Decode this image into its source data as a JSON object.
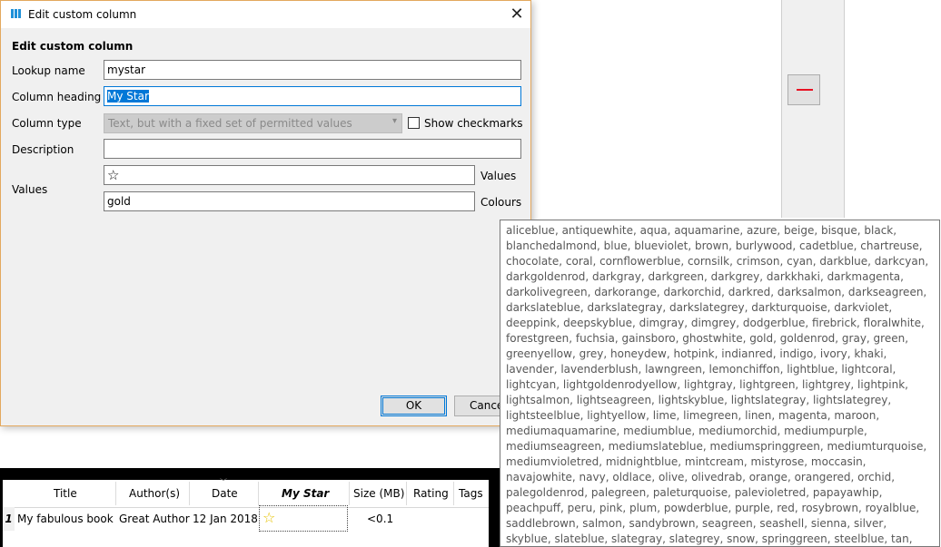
{
  "dialog": {
    "title": "Edit custom column",
    "heading": "Edit custom column",
    "lookup_name_label": "Lookup name",
    "lookup_name_value": "mystar",
    "column_heading_label": "Column heading",
    "column_heading_value": "My Star",
    "column_type_label": "Column type",
    "column_type_value": "Text, but with a fixed set of permitted values",
    "show_checkmarks_label": "Show checkmarks",
    "description_label": "Description",
    "description_value": "",
    "values_label": "Values",
    "values_value": "☆",
    "values_side_label": "Values",
    "colours_value": "gold",
    "colours_side_label": "Colours",
    "ok_label": "OK",
    "cancel_label": "Cancel",
    "close_glyph": "✕"
  },
  "remove_button": {
    "icon": "minus-icon",
    "color": "#e81123"
  },
  "table": {
    "columns": [
      "Title",
      "Author(s)",
      "Date",
      "My Star",
      "Size (MB)",
      "Rating",
      "Tags"
    ],
    "row": {
      "num": "1",
      "title": "My fabulous book",
      "author": "Great Author",
      "date": "12 Jan 2018",
      "star": "☆",
      "size": "<0.1"
    },
    "star_color": "#e6c200"
  },
  "tooltip": {
    "text": "aliceblue, antiquewhite, aqua, aquamarine, azure, beige, bisque, black, blanchedalmond, blue, blueviolet, brown, burlywood, cadetblue, chartreuse, chocolate, coral, cornflowerblue, cornsilk, crimson, cyan, darkblue, darkcyan, darkgoldenrod, darkgray, darkgreen, darkgrey, darkkhaki, darkmagenta, darkolivegreen, darkorange, darkorchid, darkred, darksalmon, darkseagreen, darkslateblue, darkslategray, darkslategrey, darkturquoise, darkviolet, deeppink, deepskyblue, dimgray, dimgrey, dodgerblue, firebrick, floralwhite, forestgreen, fuchsia, gainsboro, ghostwhite, gold, goldenrod, gray, green, greenyellow, grey, honeydew, hotpink, indianred, indigo, ivory, khaki, lavender, lavenderblush, lawngreen, lemonchiffon, lightblue, lightcoral, lightcyan, lightgoldenrodyellow, lightgray, lightgreen, lightgrey, lightpink, lightsalmon, lightseagreen, lightskyblue, lightslategray, lightslategrey, lightsteelblue, lightyellow, lime, limegreen, linen, magenta, maroon, mediumaquamarine, mediumblue, mediumorchid, mediumpurple, mediumseagreen, mediumslateblue, mediumspringgreen, mediumturquoise, mediumvioletred, midnightblue, mintcream, mistyrose, moccasin, navajowhite, navy, oldlace, olive, olivedrab, orange, orangered, orchid, palegoldenrod, palegreen, paleturquoise, palevioletred, papayawhip, peachpuff, peru, pink, plum, powderblue, purple, red, rosybrown, royalblue, saddlebrown, salmon, sandybrown, seagreen, seashell, sienna, silver, skyblue, slateblue, slategray, slategrey, snow, springgreen, steelblue, tan, teal, thistle, tomato, transparent, turquoise, violet, wheat, white, whitesmoke, yellow, yellowgreen"
  },
  "colors": {
    "accent": "#0078d7",
    "dialog_border": "#e3a85e",
    "app_icon": "#1e90d8"
  }
}
